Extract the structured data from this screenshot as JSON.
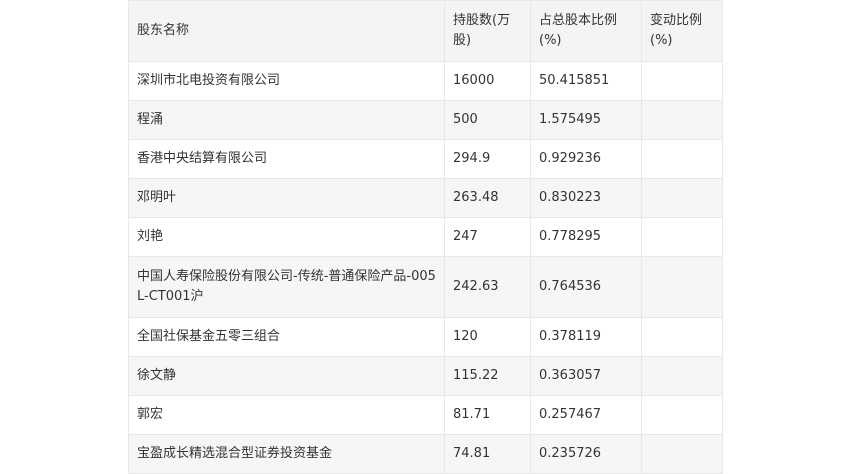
{
  "table": {
    "headers": {
      "name": "股东名称",
      "shares": "持股数(万股)",
      "ratio": "占总股本比例(%)",
      "change": "变动比例(%)"
    },
    "rows": [
      {
        "name": "深圳市北电投资有限公司",
        "shares": "16000",
        "ratio": "50.415851",
        "change": ""
      },
      {
        "name": "程涌",
        "shares": "500",
        "ratio": "1.575495",
        "change": ""
      },
      {
        "name": "香港中央结算有限公司",
        "shares": "294.9",
        "ratio": "0.929236",
        "change": ""
      },
      {
        "name": "邓明叶",
        "shares": "263.48",
        "ratio": "0.830223",
        "change": ""
      },
      {
        "name": "刘艳",
        "shares": "247",
        "ratio": "0.778295",
        "change": ""
      },
      {
        "name": "中国人寿保险股份有限公司-传统-普通保险产品-005L-CT001沪",
        "shares": "242.63",
        "ratio": "0.764536",
        "change": ""
      },
      {
        "name": "全国社保基金五零三组合",
        "shares": "120",
        "ratio": "0.378119",
        "change": ""
      },
      {
        "name": "徐文静",
        "shares": "115.22",
        "ratio": "0.363057",
        "change": ""
      },
      {
        "name": "郭宏",
        "shares": "81.71",
        "ratio": "0.257467",
        "change": ""
      },
      {
        "name": "宝盈成长精选混合型证券投资基金",
        "shares": "74.81",
        "ratio": "0.235726",
        "change": ""
      }
    ]
  }
}
